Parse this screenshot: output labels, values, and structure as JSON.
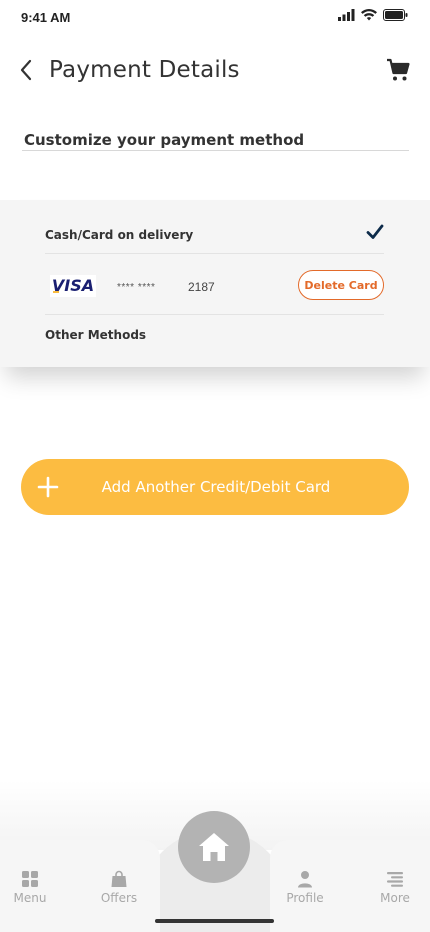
{
  "status_bar": {
    "time": "9:41 AM"
  },
  "header": {
    "title": "Payment Details"
  },
  "section": {
    "title": "Customize your payment method"
  },
  "methods": {
    "cash_label": "Cash/Card on delivery",
    "card": {
      "brand": "VISA",
      "masked": "**** ****",
      "last4": "2187",
      "delete_label": "Delete Card"
    },
    "other_label": "Other Methods"
  },
  "add_card": {
    "label": "Add Another Credit/Debit Card"
  },
  "bottom_nav": {
    "items": [
      {
        "label": "Menu",
        "icon": "grid-icon"
      },
      {
        "label": "Offers",
        "icon": "shopping-bag-icon"
      },
      {
        "label": "Profile",
        "icon": "person-icon"
      },
      {
        "label": "More",
        "icon": "list-icon"
      }
    ],
    "center_icon": "home-icon"
  },
  "colors": {
    "accent": "#fcbc41",
    "delete": "#e36a2a",
    "check": "#0d2b4a",
    "visa_blue": "#1a1f71",
    "visa_gold": "#f7a600"
  }
}
